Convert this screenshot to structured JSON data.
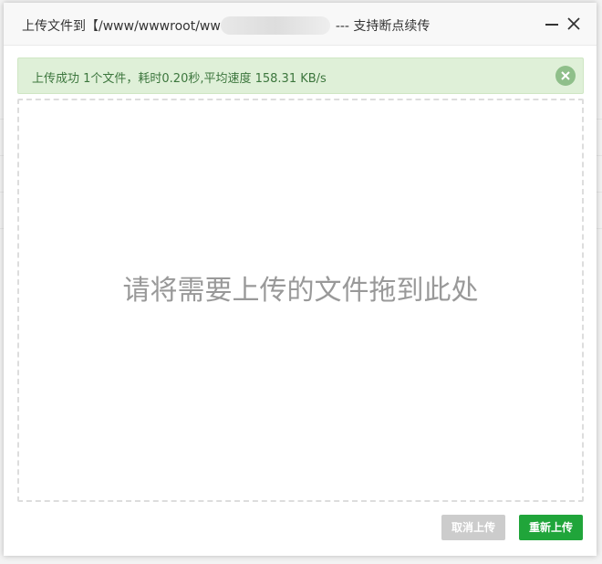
{
  "dialog": {
    "title_prefix": "上传文件到【/www/wwwroot/ww",
    "title_suffix": "--- 支持断点续传",
    "minimize_icon": "minimize-icon",
    "close_icon": "close-icon"
  },
  "alert": {
    "message": "上传成功 1个文件，耗时0.20秒,平均速度 158.31 KB/s",
    "close_icon": "close-circle-icon"
  },
  "dropzone": {
    "hint": "请将需要上传的文件拖到此处"
  },
  "buttons": {
    "cancel": "取消上传",
    "reupload": "重新上传"
  },
  "colors": {
    "success_bg": "#dff0d8",
    "success_text": "#3c763d",
    "primary_green": "#20a53a",
    "disabled_gray": "#cccccc"
  }
}
